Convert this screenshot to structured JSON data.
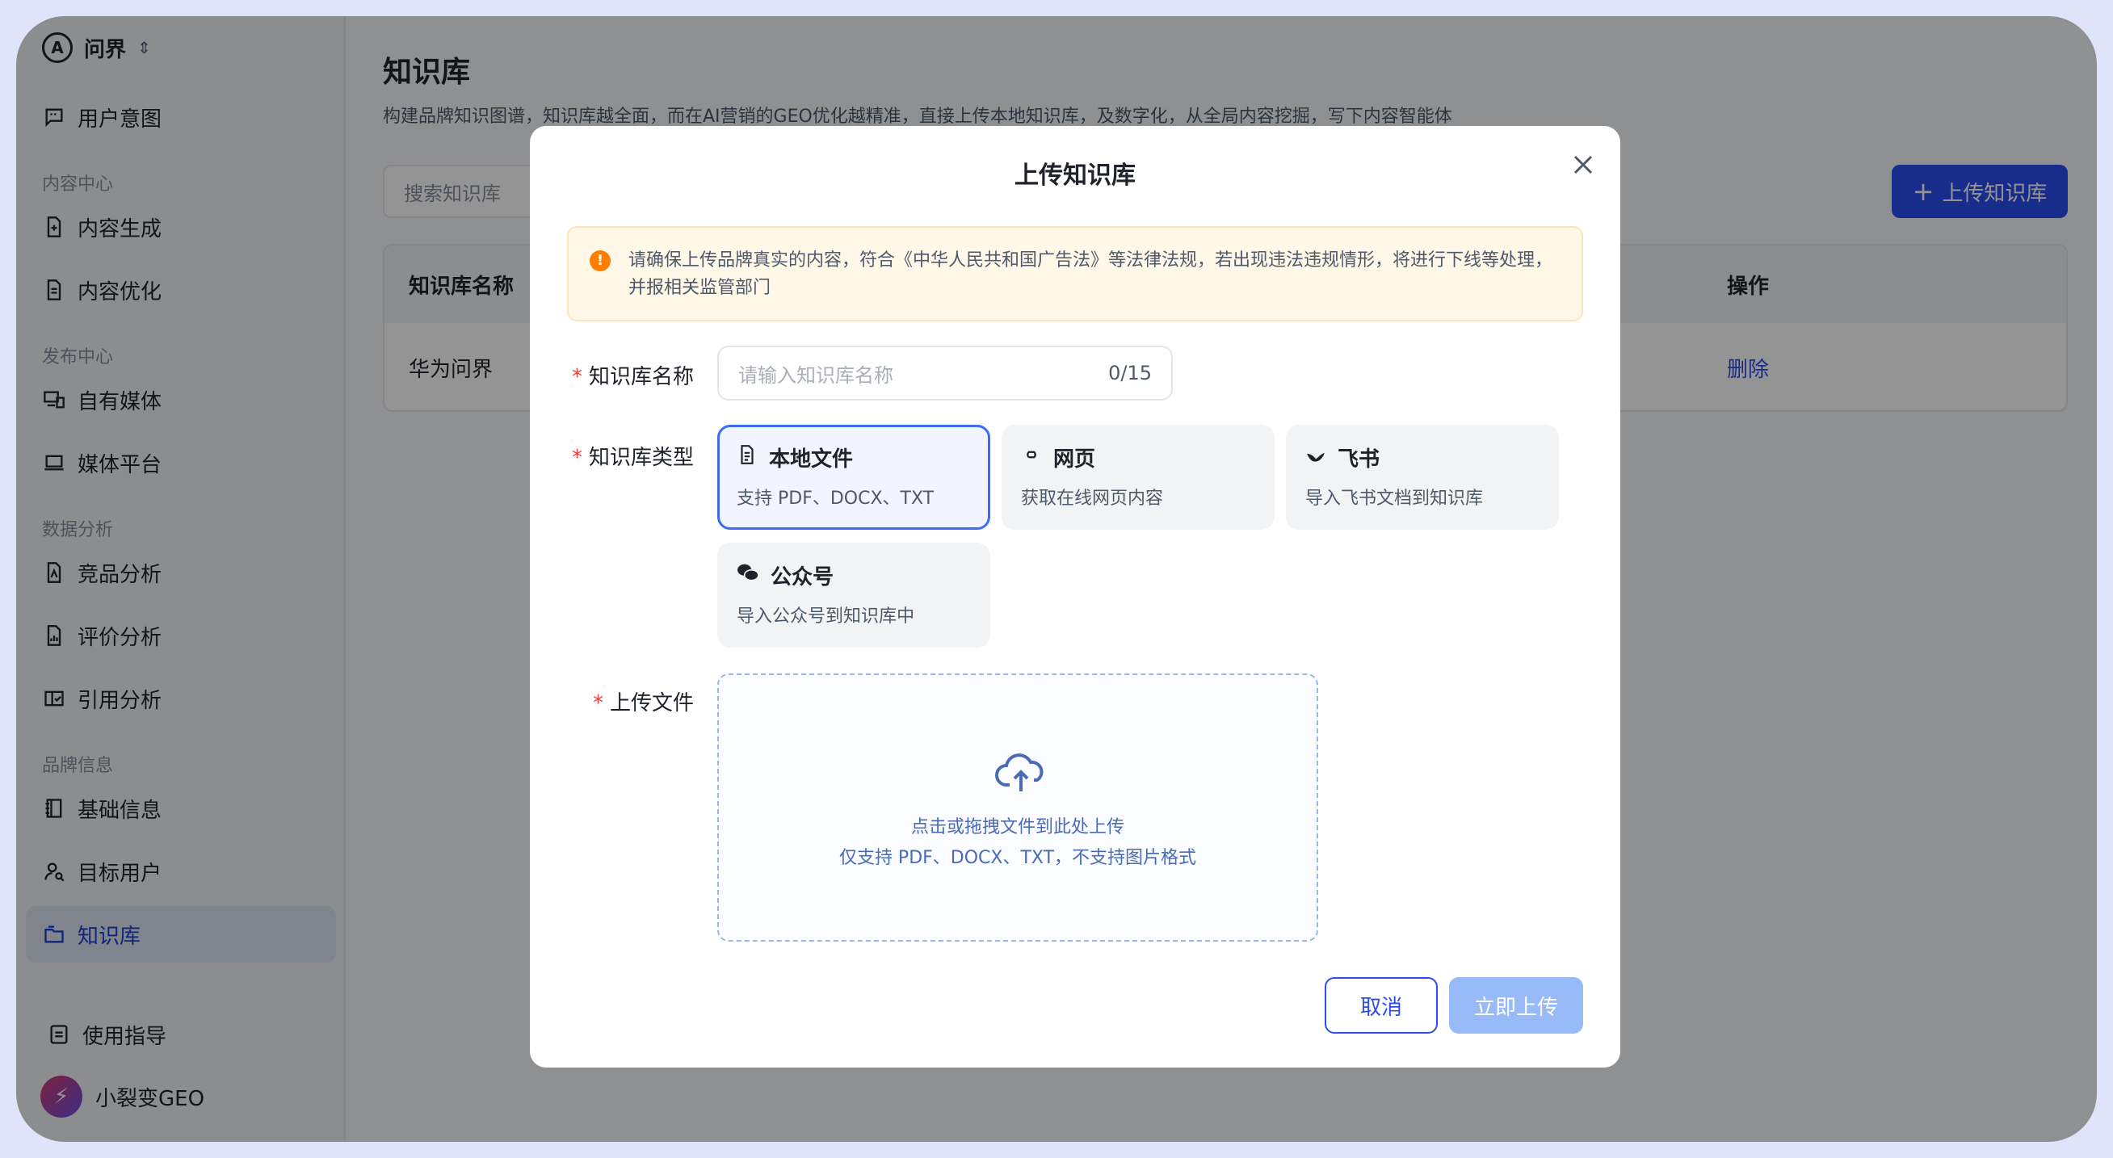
{
  "sidebar": {
    "brand": "问界",
    "items": [
      {
        "label": "用户意图",
        "icon": "message-square-icon"
      },
      {
        "label": "内容生成",
        "icon": "file-plus-icon"
      },
      {
        "label": "内容优化",
        "icon": "file-text-icon"
      },
      {
        "label": "自有媒体",
        "icon": "devices-icon"
      },
      {
        "label": "媒体平台",
        "icon": "laptop-icon"
      },
      {
        "label": "竞品分析",
        "icon": "file-chart-icon"
      },
      {
        "label": "评价分析",
        "icon": "file-bar-icon"
      },
      {
        "label": "引用分析",
        "icon": "book-open-icon"
      },
      {
        "label": "基础信息",
        "icon": "notebook-icon"
      },
      {
        "label": "目标用户",
        "icon": "user-search-icon"
      },
      {
        "label": "知识库",
        "icon": "folder-icon"
      }
    ],
    "sections": [
      "内容中心",
      "发布中心",
      "数据分析",
      "品牌信息"
    ],
    "guide": "使用指导",
    "user_name": "小裂变GEO"
  },
  "page": {
    "title": "知识库",
    "desc": "构建品牌知识图谱，知识库越全面，而在AI营销的GEO优化越精准，直接上传本地知识库，及数字化，从全局内容挖掘，写下内容智能体",
    "search_placeholder": "搜索知识库",
    "upload_button": "上传知识库",
    "table": {
      "headers": [
        "知识库名称",
        "操作"
      ],
      "rows": [
        {
          "name": "华为问界",
          "action": "删除"
        }
      ]
    }
  },
  "modal": {
    "title": "上传知识库",
    "warning": "请确保上传品牌真实的内容，符合《中华人民共和国广告法》等法律法规，若出现违法违规情形，将进行下线等处理，并报相关监管部门",
    "name_label": "知识库名称",
    "name_placeholder": "请输入知识库名称",
    "name_counter": "0/15",
    "type_label": "知识库类型",
    "types": [
      {
        "title": "本地文件",
        "sub": "支持 PDF、DOCX、TXT",
        "icon": "document-icon",
        "selected": true
      },
      {
        "title": "网页",
        "sub": "获取在线网页内容",
        "icon": "link-icon",
        "selected": false
      },
      {
        "title": "飞书",
        "sub": "导入飞书文档到知识库",
        "icon": "feishu-icon",
        "selected": false
      },
      {
        "title": "公众号",
        "sub": "导入公众号到知识库中",
        "icon": "wechat-icon",
        "selected": false
      }
    ],
    "file_label": "上传文件",
    "drop_line1": "点击或拖拽文件到此处上传",
    "drop_line2": "仅支持 PDF、DOCX、TXT，不支持图片格式",
    "cancel": "取消",
    "submit": "立即上传"
  },
  "colors": {
    "accent": "#2a4cf0",
    "warning": "#ff7d00",
    "required": "#f53f3f",
    "submit_disabled": "#98baf8"
  }
}
